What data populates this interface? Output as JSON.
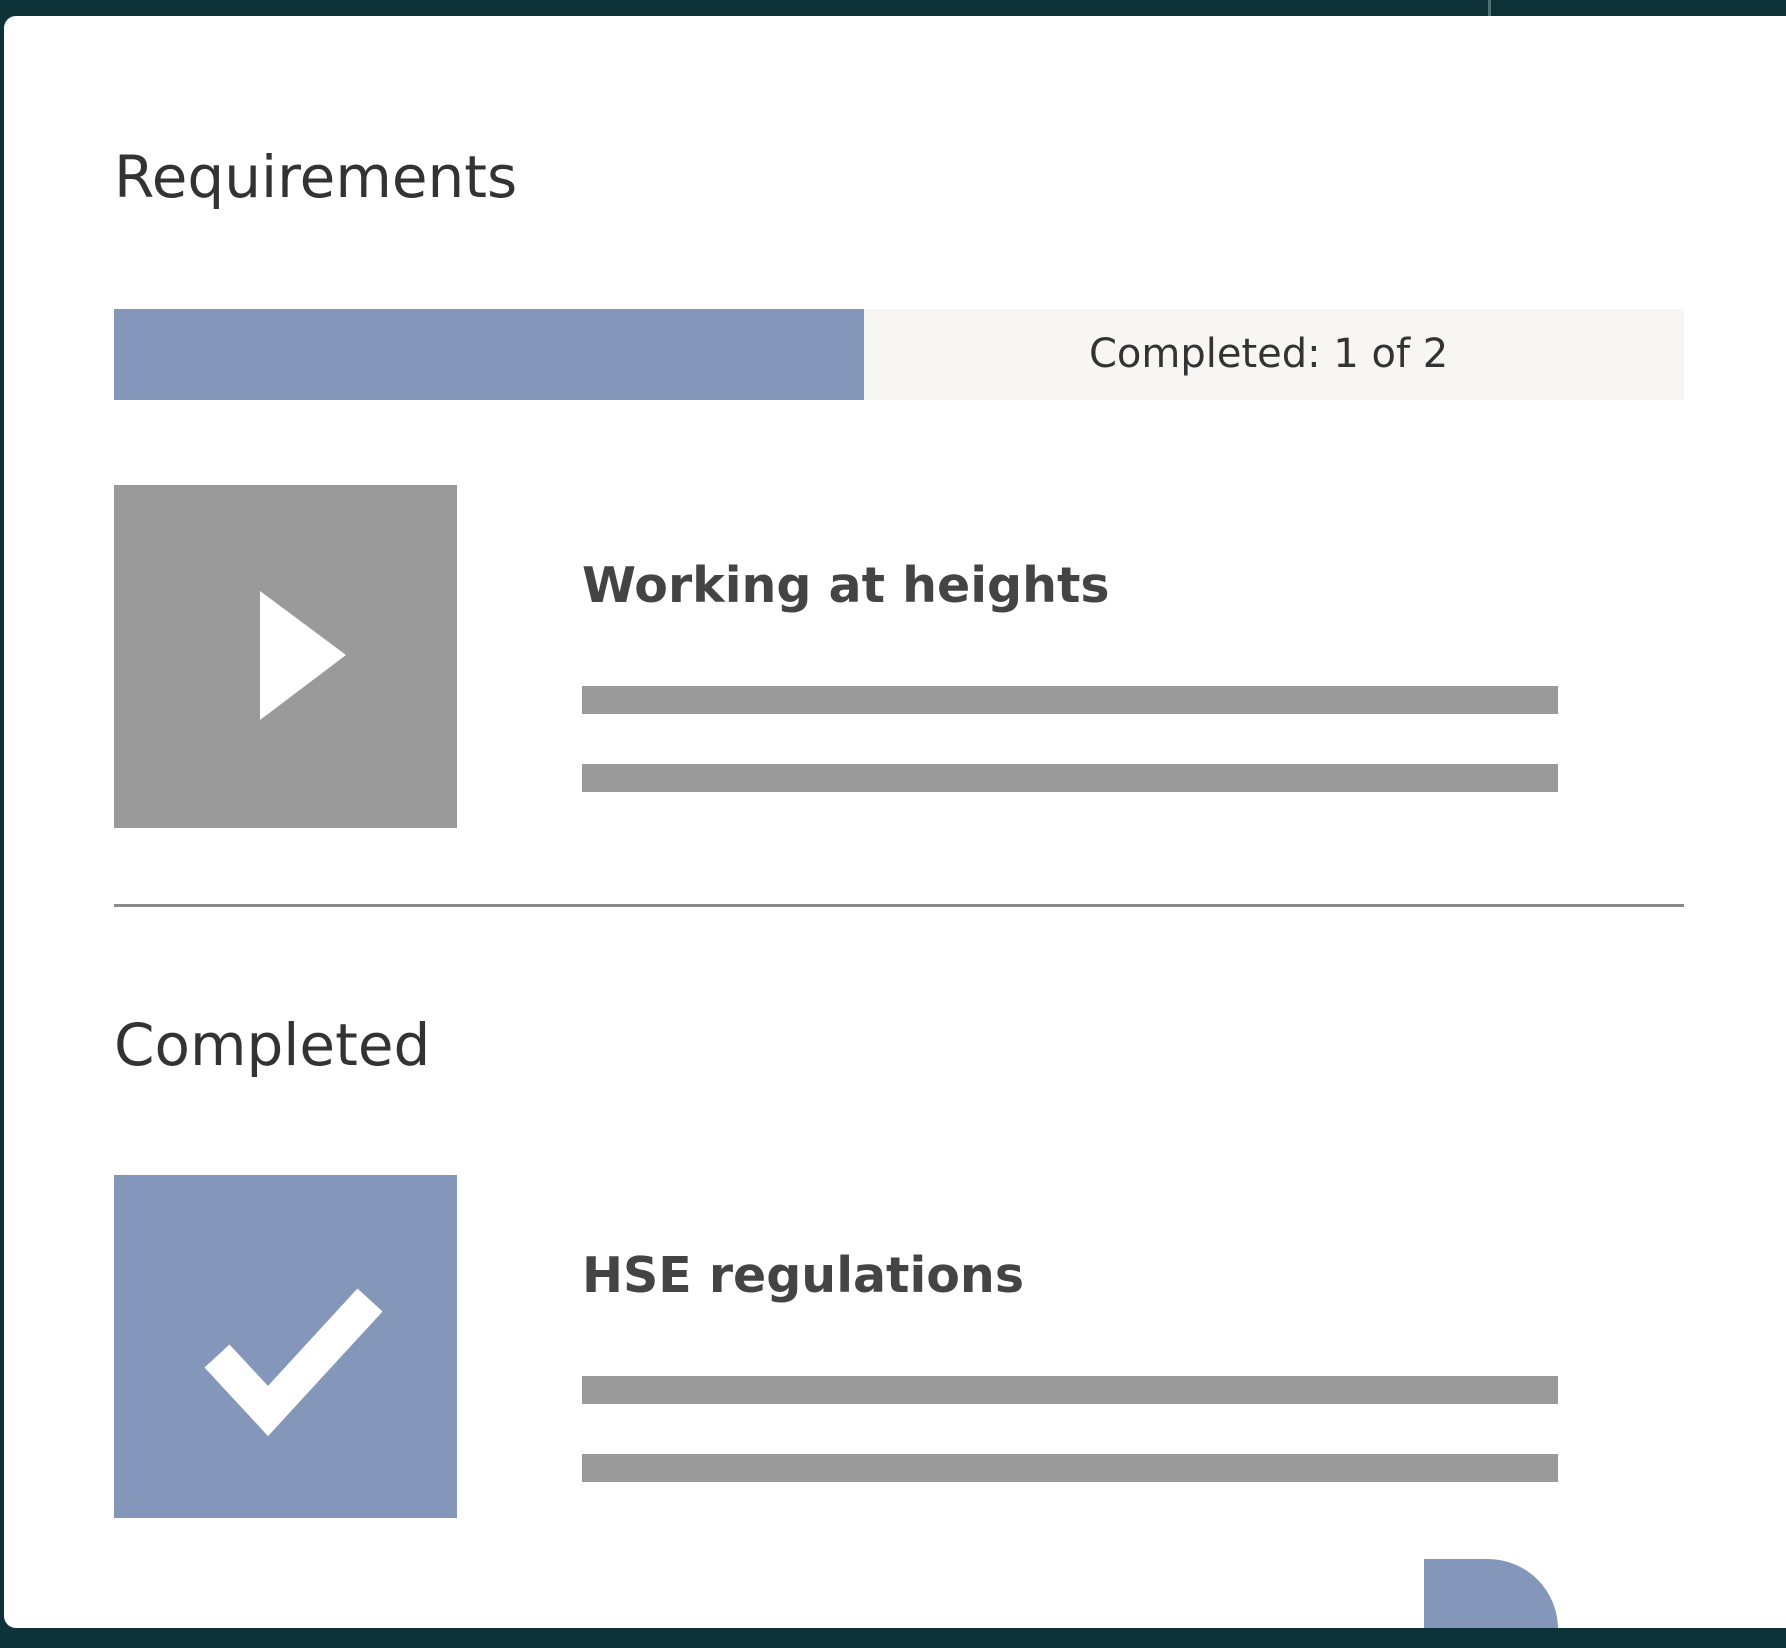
{
  "requirements": {
    "title": "Requirements",
    "progress": {
      "label": "Completed: 1 of 2",
      "completed": 1,
      "total": 2,
      "fill_fraction": 0.478
    },
    "items": [
      {
        "title": "Working at heights",
        "icon": "play-icon"
      }
    ]
  },
  "completed": {
    "title": "Completed",
    "items": [
      {
        "title": "HSE regulations",
        "icon": "checkmark-icon"
      }
    ]
  },
  "colors": {
    "background": "#0d3338",
    "card": "#ffffff",
    "accent": "#8497ba",
    "placeholder_gray": "#9a9a9a",
    "track": "#f7f6f2",
    "text": "#333333"
  }
}
